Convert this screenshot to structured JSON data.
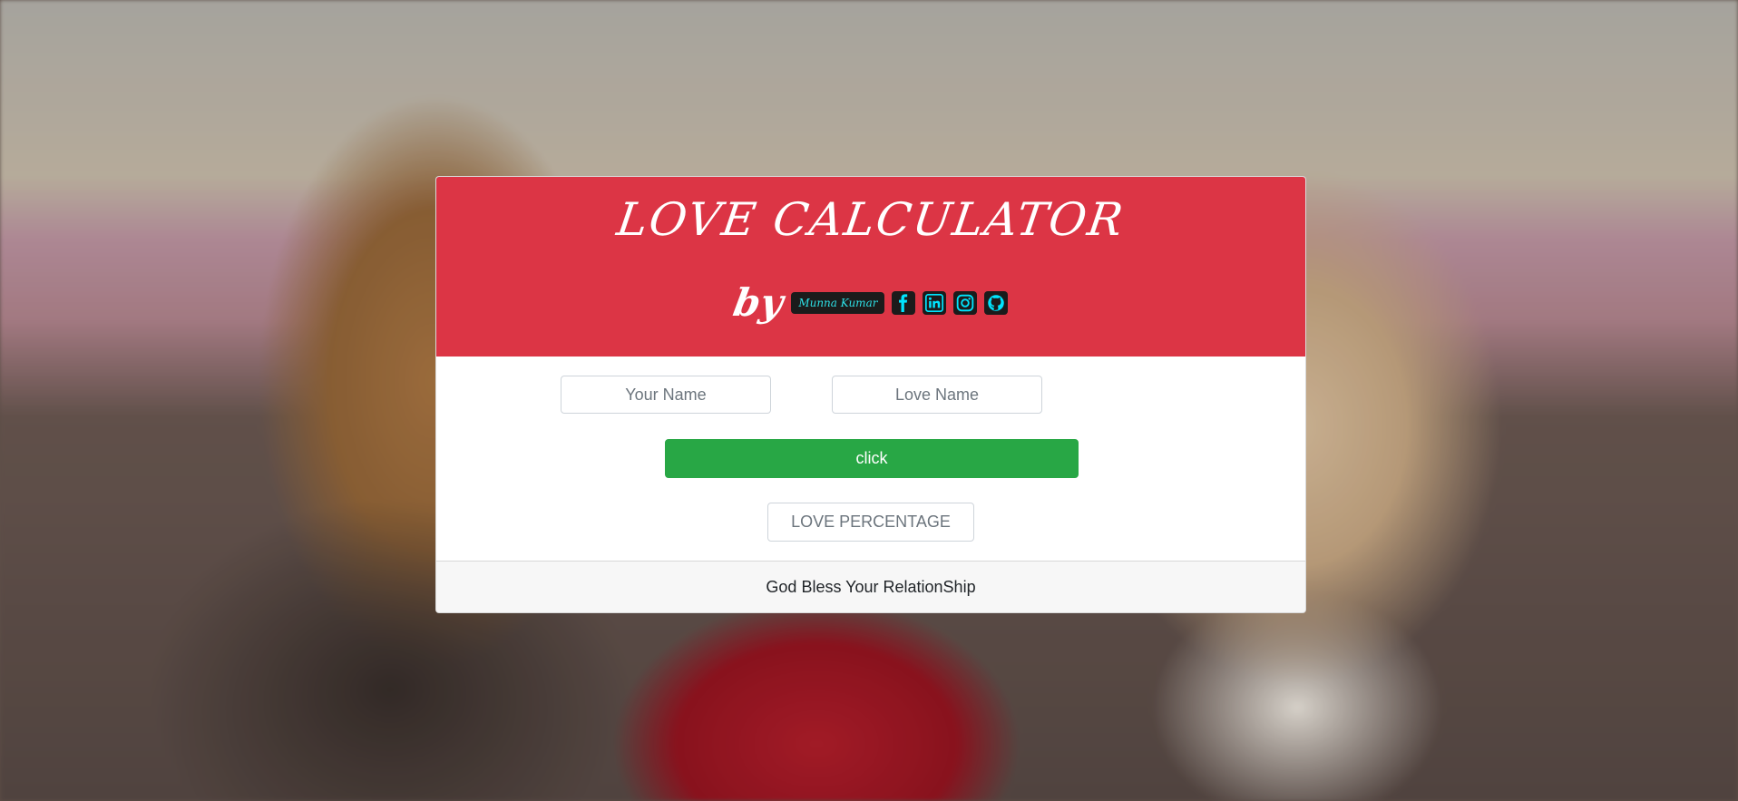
{
  "header": {
    "title": "LOVE CALCULATOR",
    "by_label": "by",
    "author": "Munna Kumar"
  },
  "social": [
    {
      "icon": "facebook-icon"
    },
    {
      "icon": "linkedin-icon"
    },
    {
      "icon": "instagram-icon"
    },
    {
      "icon": "github-icon"
    }
  ],
  "form": {
    "your_name_placeholder": "Your Name",
    "love_name_placeholder": "Love Name",
    "plus": "+",
    "button_label": "click",
    "result_label": "LOVE PERCENTAGE"
  },
  "footer": {
    "text": "God Bless Your RelationShip"
  },
  "colors": {
    "header": "#dc3545",
    "button": "#28a745",
    "author_text": "#2de0e6",
    "social_icon": "#00e5ff"
  }
}
